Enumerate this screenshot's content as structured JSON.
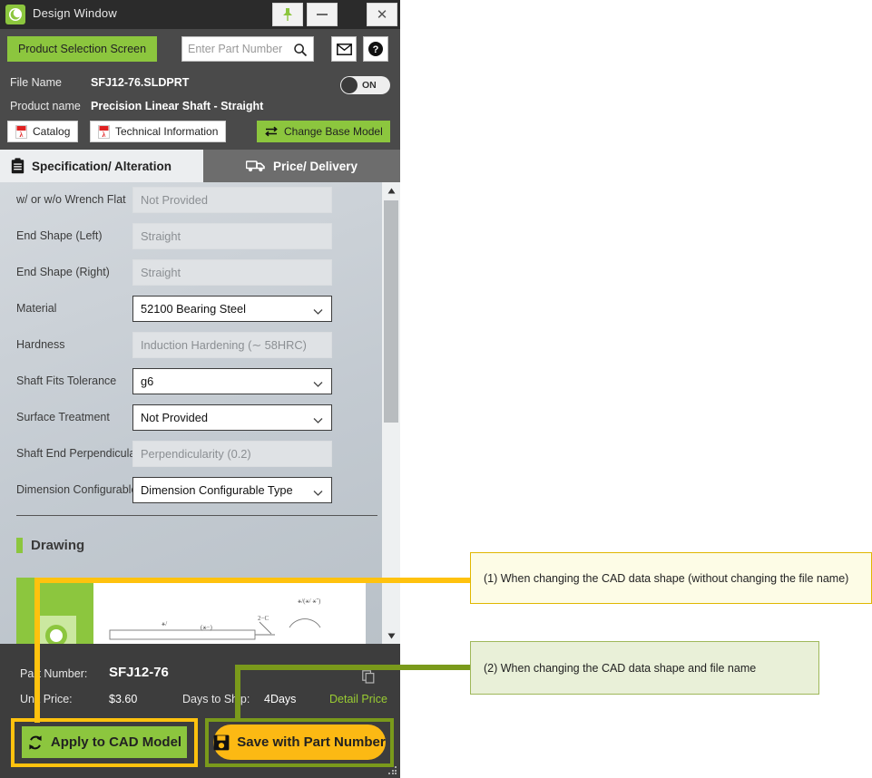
{
  "window": {
    "title": "Design Window",
    "logo_icon": "misumi-c-logo",
    "buttons": [
      {
        "name": "pin",
        "icon": "pushpin-icon",
        "label": ""
      },
      {
        "name": "minimize",
        "icon": "minimize-icon",
        "label": ""
      },
      {
        "name": "close",
        "icon": "close-icon",
        "label": "✕"
      }
    ]
  },
  "toolbar": {
    "product_selection_label": "Product Selection Screen",
    "search_placeholder": "Enter Part Number",
    "search_value": "",
    "search_icon": "search-icon",
    "mail_icon": "mail-icon",
    "help_icon": "help-icon"
  },
  "product": {
    "file_name_label": "File Name",
    "file_name_value": "SFJ12-76.SLDPRT",
    "product_name_label": "Product name",
    "product_name_value": "Precision Linear Shaft - Straight",
    "toggle_state": "ON",
    "catalog_label": "Catalog",
    "technical_label": "Technical Information",
    "change_base_label": "Change Base Model",
    "pdf_icon": "pdf-icon",
    "swap_icon": "swap-arrows-icon"
  },
  "tabs": [
    {
      "label": "Specification/ Alteration",
      "icon": "clipboard-icon",
      "active": true
    },
    {
      "label": "Price/ Delivery",
      "icon": "truck-icon",
      "active": false
    }
  ],
  "spec_fields": [
    {
      "label": "w/ or w/o Wrench Flat",
      "value": "Not Provided",
      "type": "readonly"
    },
    {
      "label": "End Shape (Left)",
      "value": "Straight",
      "type": "readonly"
    },
    {
      "label": "End Shape (Right)",
      "value": "Straight",
      "type": "readonly"
    },
    {
      "label": "Material",
      "value": "52100 Bearing Steel",
      "type": "select"
    },
    {
      "label": "Hardness",
      "value": "Induction Hardening (∼ 58HRC)",
      "type": "readonly"
    },
    {
      "label": "Shaft Fits Tolerance",
      "value": "g6",
      "type": "select"
    },
    {
      "label": "Surface Treatment",
      "value": "Not Provided",
      "type": "select"
    },
    {
      "label": "Shaft End Perpendicularity",
      "value": "Perpendicularity (0.2)",
      "type": "readonly"
    },
    {
      "label": "Dimension Configurable Type",
      "value": "Dimension Configurable Type",
      "type": "select"
    }
  ],
  "drawing": {
    "section_title": "Drawing",
    "annotations": [
      "2−C",
      "(∇)",
      "∇"
    ]
  },
  "scrollbar": {
    "up_icon": "scroll-up-icon",
    "down_icon": "scroll-down-icon"
  },
  "bottom": {
    "part_number_label": "Part Number:",
    "part_number_value": "SFJ12-76",
    "unit_price_label": "Unit Price:",
    "unit_price_value": "$3.60",
    "days_label": "Days to Ship:",
    "days_value": "4Days",
    "detail_price_label": "Detail Price",
    "copy_icon": "copy-icon",
    "apply_label": "Apply to CAD Model",
    "apply_icon": "refresh-cycle-icon",
    "save_label": "Save with Part Number",
    "save_icon": "floppy-save-icon"
  },
  "annotations": {
    "callout1": "(1) When changing the CAD data shape (without changing the file name)",
    "callout2": "(2) When changing the CAD data shape and file name"
  },
  "colors": {
    "accent_green": "#8cc63e",
    "highlight_orange": "#ffc20e",
    "highlight_olive": "#7a9a1b",
    "save_amber": "#fcb913",
    "detail_link": "#9acd32"
  }
}
